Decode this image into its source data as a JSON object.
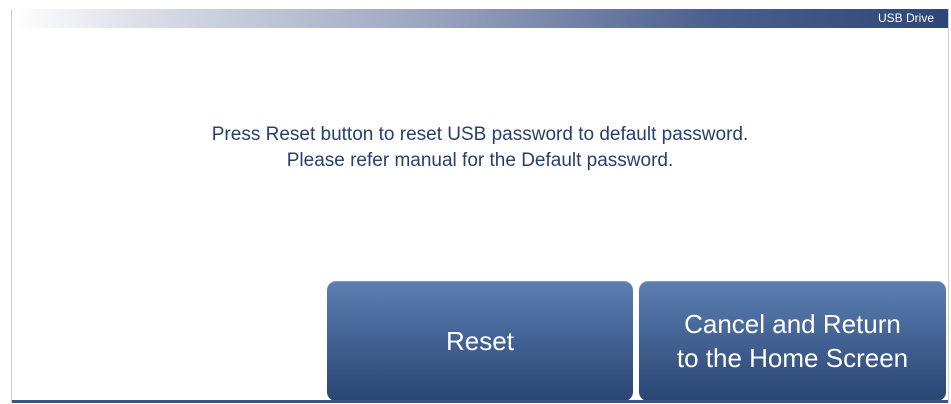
{
  "header": {
    "title": "USB Drive"
  },
  "message": {
    "line1": "Press Reset button to reset USB password to default password.",
    "line2": "Please refer manual for the Default password."
  },
  "buttons": {
    "reset_label": "Reset",
    "cancel_line1": "Cancel and Return",
    "cancel_line2": "to the Home Screen"
  },
  "colors": {
    "accent": "#2e4677",
    "message_text": "#27406e",
    "button_top": "#5c7fb1",
    "button_bottom": "#2a4573"
  }
}
